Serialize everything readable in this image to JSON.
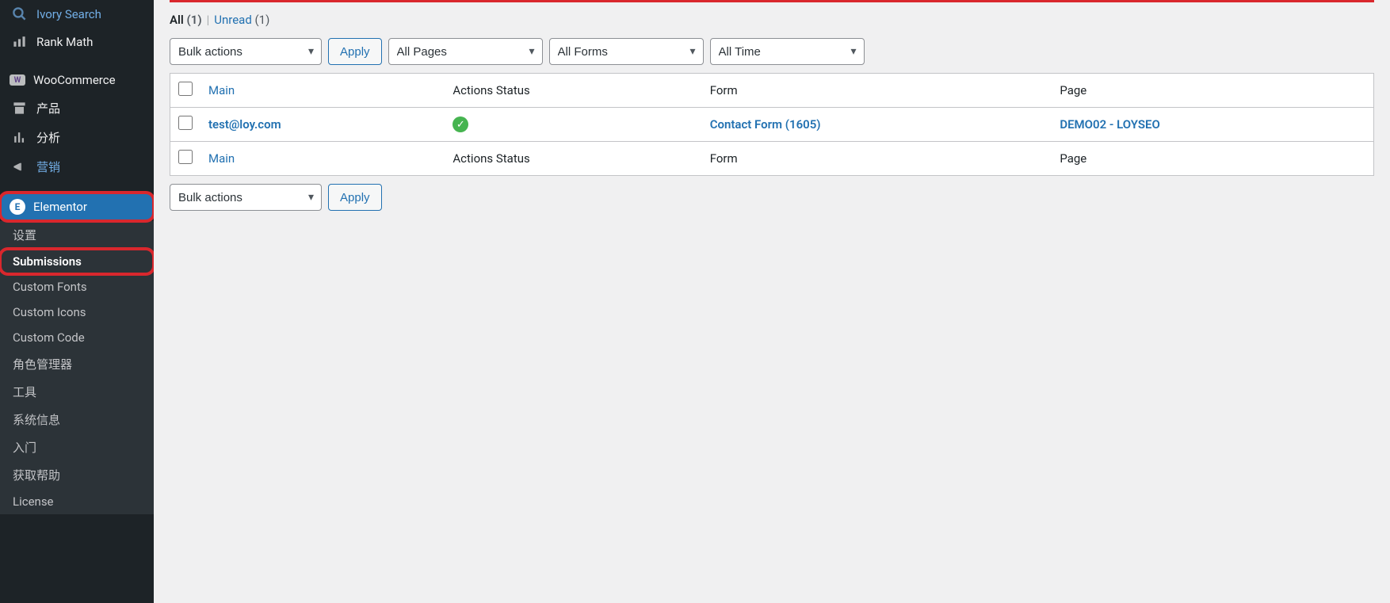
{
  "sidebar": {
    "items": [
      {
        "icon": "search",
        "label": "Ivory Search"
      },
      {
        "icon": "chart-bar",
        "label": "Rank Math"
      }
    ],
    "items2": [
      {
        "icon": "woo",
        "label": "WooCommerce"
      },
      {
        "icon": "archive",
        "label": "产品"
      },
      {
        "icon": "analytics",
        "label": "分析"
      },
      {
        "icon": "megaphone",
        "label": "营销",
        "link": true
      }
    ],
    "elementor": {
      "icon": "elementor",
      "label": "Elementor"
    },
    "submenu": [
      {
        "label": "设置"
      },
      {
        "label": "Submissions",
        "active": true
      },
      {
        "label": "Custom Fonts"
      },
      {
        "label": "Custom Icons"
      },
      {
        "label": "Custom Code"
      },
      {
        "label": "角色管理器"
      },
      {
        "label": "工具"
      },
      {
        "label": "系统信息"
      },
      {
        "label": "入门"
      },
      {
        "label": "获取帮助"
      },
      {
        "label": "License"
      }
    ]
  },
  "filters": {
    "all_label": "All",
    "all_count": "(1)",
    "unread_label": "Unread",
    "unread_count": "(1)"
  },
  "tablenav": {
    "bulk_actions": "Bulk actions",
    "apply": "Apply",
    "all_pages": "All Pages",
    "all_forms": "All Forms",
    "all_time": "All Time"
  },
  "table": {
    "headers": {
      "main": "Main",
      "actions_status": "Actions Status",
      "form": "Form",
      "page": "Page"
    },
    "rows": [
      {
        "main": "test@loy.com",
        "status": "success",
        "form": "Contact Form (1605)",
        "page": "DEMO02 - LOYSEO"
      }
    ]
  }
}
